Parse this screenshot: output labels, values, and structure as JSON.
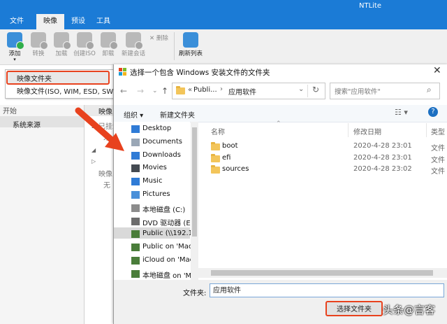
{
  "app": {
    "title": "NTLite",
    "menu": [
      "文件",
      "映像",
      "预设",
      "工具"
    ],
    "ribbon": {
      "add": "添加",
      "convert": "转换",
      "load": "加载",
      "create_iso": "创建ISO",
      "unload": "卸载",
      "new_session": "新建会话",
      "delete": "删除",
      "refresh": "刷新列表"
    },
    "dropdown": [
      "映像文件夹",
      "映像文件(ISO, WIM, ESD, SWM)"
    ],
    "left_pane": {
      "header": "开始",
      "item": "系统来源"
    },
    "main": {
      "header": "映像",
      "tree": [
        "已挂载",
        "未",
        "",
        "映像",
        "无"
      ]
    }
  },
  "dialog": {
    "title": "选择一个包含 Windows 安装文件的文件夹",
    "address": {
      "prefix": "«",
      "crumb1": "Publi...",
      "crumb2": "应用软件"
    },
    "search_placeholder": "搜索\"应用软件\"",
    "toolbar": {
      "organize": "组织 ▾",
      "new_folder": "新建文件夹"
    },
    "nav_items": [
      {
        "label": "Desktop",
        "icon": "desktop-icon",
        "color": "#2f7bd6"
      },
      {
        "label": "Documents",
        "icon": "documents-icon",
        "color": "#9aa7b6"
      },
      {
        "label": "Downloads",
        "icon": "downloads-icon",
        "color": "#2f7bd6"
      },
      {
        "label": "Movies",
        "icon": "movies-icon",
        "color": "#444a52"
      },
      {
        "label": "Music",
        "icon": "music-icon",
        "color": "#2f7bd6"
      },
      {
        "label": "Pictures",
        "icon": "pictures-icon",
        "color": "#4a90d9"
      },
      {
        "label": "本地磁盘 (C:)",
        "icon": "drive-icon",
        "color": "#8c8c8c"
      },
      {
        "label": "DVD 驱动器 (E:)",
        "icon": "dvd-icon",
        "color": "#6c6c6c"
      },
      {
        "label": "Public (\\\\192.16",
        "icon": "network-drive-icon",
        "color": "#4a7d3a"
      },
      {
        "label": "Public on 'Mac",
        "icon": "network-drive-icon",
        "color": "#4a7d3a"
      },
      {
        "label": "iCloud on 'Mac",
        "icon": "network-drive-icon",
        "color": "#4a7d3a"
      },
      {
        "label": "本地磁盘 on 'M",
        "icon": "network-drive-icon",
        "color": "#4a7d3a"
      }
    ],
    "columns": {
      "name": "名称",
      "date": "修改日期",
      "type": "类型"
    },
    "files": [
      {
        "name": "boot",
        "date": "2020-4-28 23:01",
        "type": "文件"
      },
      {
        "name": "efi",
        "date": "2020-4-28 23:01",
        "type": "文件"
      },
      {
        "name": "sources",
        "date": "2020-4-28 23:02",
        "type": "文件"
      }
    ],
    "folder_label": "文件夹:",
    "folder_value": "应用软件",
    "select_button": "选择文件夹"
  },
  "watermark": "头条@言客",
  "colors": {
    "accent": "#1b7bd6",
    "highlight": "#e8421e"
  }
}
